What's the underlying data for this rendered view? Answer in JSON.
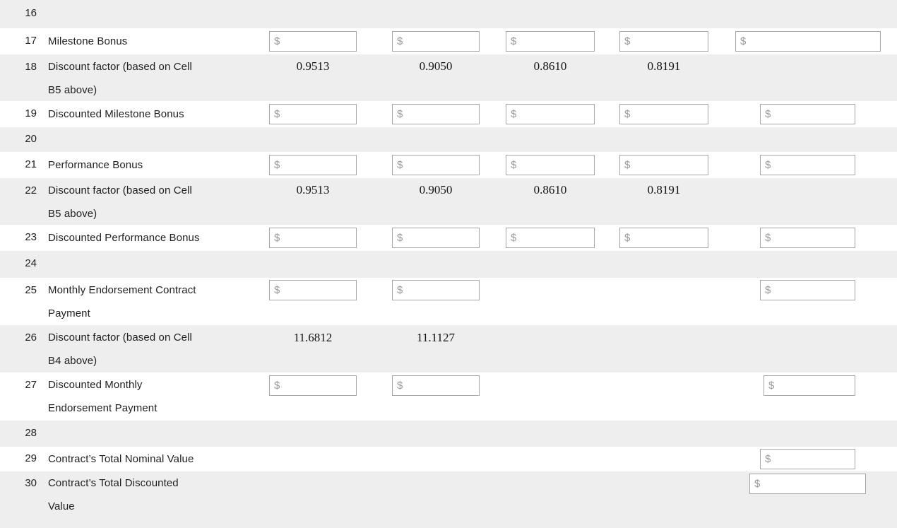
{
  "sheet": {
    "currency_placeholder": "$",
    "rows": [
      {
        "number": "16",
        "label": "",
        "label_line2": "",
        "values": [],
        "inputs": []
      },
      {
        "number": "17",
        "label": "Milestone Bonus",
        "label_line2": "",
        "values": [],
        "inputs": [
          "$",
          "$",
          "$",
          "$",
          "$"
        ]
      },
      {
        "number": "18",
        "label": "Discount factor (based on Cell",
        "label_line2": "B5 above)",
        "values": [
          "0.9513",
          "0.9050",
          "0.8610",
          "0.8191"
        ],
        "inputs": []
      },
      {
        "number": "19",
        "label": "Discounted Milestone Bonus",
        "label_line2": "",
        "values": [],
        "inputs": [
          "$",
          "$",
          "$",
          "$",
          "$"
        ]
      },
      {
        "number": "20",
        "label": "",
        "label_line2": "",
        "values": [],
        "inputs": []
      },
      {
        "number": "21",
        "label": "Performance Bonus",
        "label_line2": "",
        "values": [],
        "inputs": [
          "$",
          "$",
          "$",
          "$",
          "$"
        ]
      },
      {
        "number": "22",
        "label": "Discount factor (based on Cell",
        "label_line2": "B5 above)",
        "values": [
          "0.9513",
          "0.9050",
          "0.8610",
          "0.8191"
        ],
        "inputs": []
      },
      {
        "number": "23",
        "label": "Discounted Performance Bonus",
        "label_line2": "",
        "values": [],
        "inputs": [
          "$",
          "$",
          "$",
          "$",
          "$"
        ]
      },
      {
        "number": "24",
        "label": "",
        "label_line2": "",
        "values": [],
        "inputs": []
      },
      {
        "number": "25",
        "label": "Monthly Endorsement Contract",
        "label_line2": "Payment",
        "values": [],
        "inputs": [
          "$",
          "$",
          "$"
        ]
      },
      {
        "number": "26",
        "label": "Discount factor (based on Cell",
        "label_line2": "B4 above)",
        "values": [
          "11.6812",
          "11.1127"
        ],
        "inputs": []
      },
      {
        "number": "27",
        "label": "Discounted Monthly",
        "label_line2": "Endorsement Payment",
        "values": [],
        "inputs": [
          "$",
          "$",
          "$"
        ]
      },
      {
        "number": "28",
        "label": "",
        "label_line2": "",
        "values": [],
        "inputs": []
      },
      {
        "number": "29",
        "label": "Contract’s Total Nominal Value",
        "label_line2": "",
        "values": [],
        "inputs": [
          "$"
        ]
      },
      {
        "number": "30",
        "label": "Contract’s Total Discounted",
        "label_line2": "Value",
        "values": [],
        "inputs": [
          "$"
        ]
      }
    ]
  },
  "colors": {
    "shaded_row": "#eeeeee",
    "plain_row": "#ffffff",
    "input_border": "#a6a6a6",
    "placeholder": "#9a9a9a",
    "text": "#1f1f1f"
  }
}
